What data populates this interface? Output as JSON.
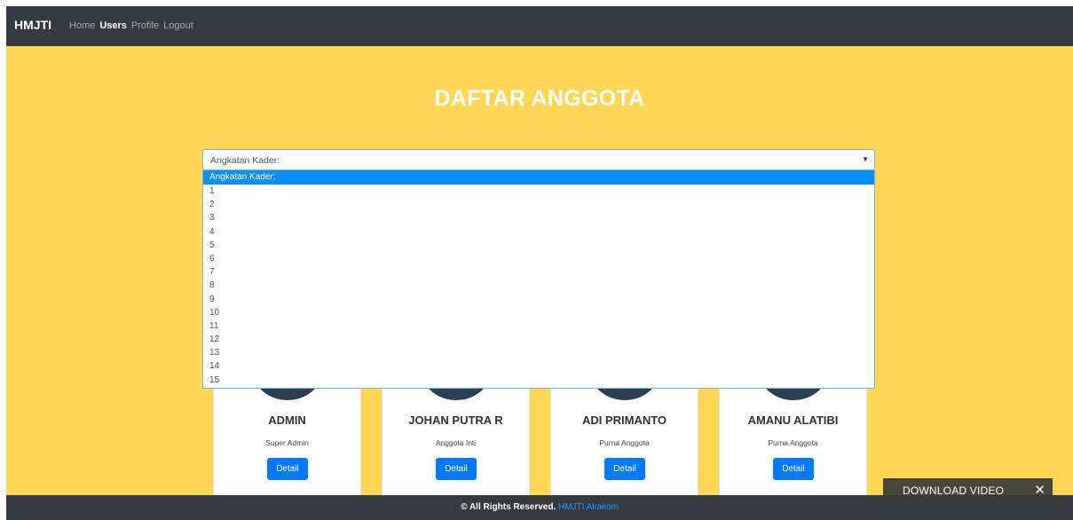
{
  "navbar": {
    "brand": "HMJTI",
    "links": [
      {
        "label": "Home",
        "active": false
      },
      {
        "label": "Users",
        "active": true
      },
      {
        "label": "Profile",
        "active": false
      },
      {
        "label": "Logout",
        "active": false
      }
    ]
  },
  "hero": {
    "title": "DAFTAR ANGGOTA"
  },
  "filter": {
    "selected": "Angkatan Kader:",
    "options": [
      "Angkatan Kader:",
      "1",
      "2",
      "3",
      "4",
      "5",
      "6",
      "7",
      "8",
      "9",
      "10",
      "11",
      "12",
      "13",
      "14",
      "15"
    ]
  },
  "members": [
    {
      "name": "ADMIN",
      "role": "Super Admin",
      "button": "Detail"
    },
    {
      "name": "JOHAN PUTRA R",
      "role": "Anggota Inti",
      "button": "Detail"
    },
    {
      "name": "ADI PRIMANTO",
      "role": "Purna Anggota",
      "button": "Detail"
    },
    {
      "name": "AMANU ALATIBI",
      "role": "Purna Anggota",
      "button": "Detail"
    }
  ],
  "footer": {
    "text": "© All Rights Reserved.",
    "link": "HMJTI Akakom"
  },
  "download_bar": {
    "label": "DOWNLOAD VIDEO",
    "close": "✕"
  },
  "colors": {
    "navbar_bg": "#343a40",
    "hero_bg": "#ffd755",
    "primary": "#007bff",
    "avatar": "#2c3e50"
  }
}
